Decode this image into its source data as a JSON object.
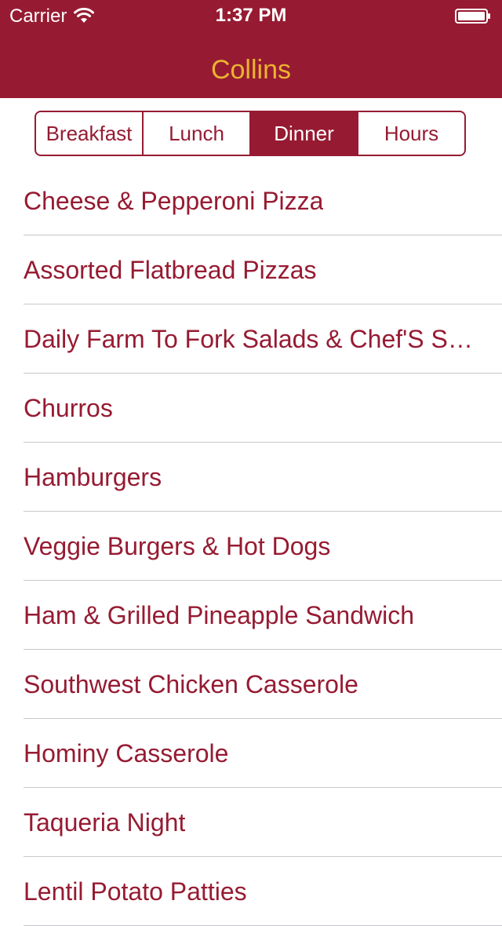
{
  "status_bar": {
    "carrier": "Carrier",
    "time": "1:37 PM",
    "wifi_icon": "wifi-icon",
    "battery_icon": "battery-icon"
  },
  "nav": {
    "title": "Collins"
  },
  "segments": [
    {
      "label": "Breakfast",
      "selected": false
    },
    {
      "label": "Lunch",
      "selected": false
    },
    {
      "label": "Dinner",
      "selected": true
    },
    {
      "label": "Hours",
      "selected": false
    }
  ],
  "menu_items": [
    "Cheese & Pepperoni Pizza",
    "Assorted Flatbread Pizzas",
    "Daily Farm To Fork Salads & Chef'S Specials",
    "Churros",
    "Hamburgers",
    "Veggie Burgers & Hot Dogs",
    "Ham & Grilled Pineapple Sandwich",
    "Southwest Chicken Casserole",
    "Hominy Casserole",
    "Taqueria Night",
    "Lentil Potato Patties"
  ],
  "colors": {
    "brand": "#961b32",
    "title": "#ebb42f",
    "separator": "#c8c7cc",
    "background": "#ffffff"
  }
}
